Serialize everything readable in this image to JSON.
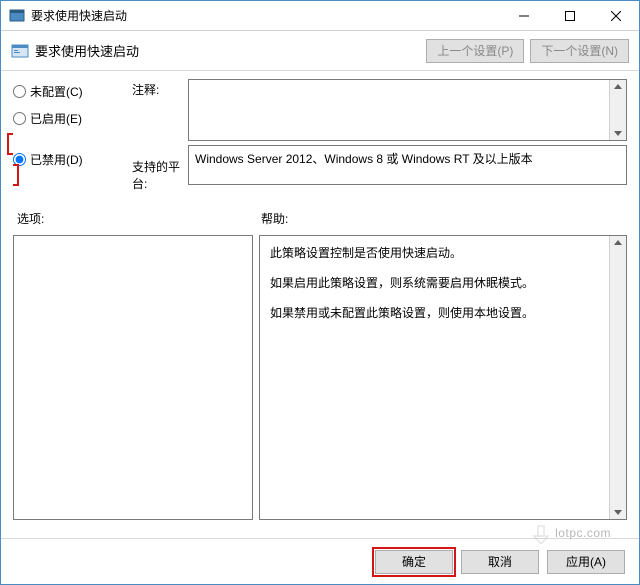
{
  "window": {
    "title": "要求使用快速启动"
  },
  "toolbar": {
    "title": "要求使用快速启动",
    "prev": "上一个设置(P)",
    "next": "下一个设置(N)"
  },
  "radios": {
    "not_configured": "未配置(C)",
    "enabled": "已启用(E)",
    "disabled": "已禁用(D)",
    "selected": "disabled"
  },
  "labels": {
    "comment": "注释:",
    "platform": "支持的平台:",
    "options": "选项:",
    "help": "帮助:"
  },
  "platform_text": "Windows Server 2012、Windows 8 或 Windows RT 及以上版本",
  "help": {
    "p1": "此策略设置控制是否使用快速启动。",
    "p2": "如果启用此策略设置，则系统需要启用休眠模式。",
    "p3": "如果禁用或未配置此策略设置，则使用本地设置。"
  },
  "buttons": {
    "ok": "确定",
    "cancel": "取消",
    "apply": "应用(A)"
  },
  "watermark": "lotpc.com"
}
